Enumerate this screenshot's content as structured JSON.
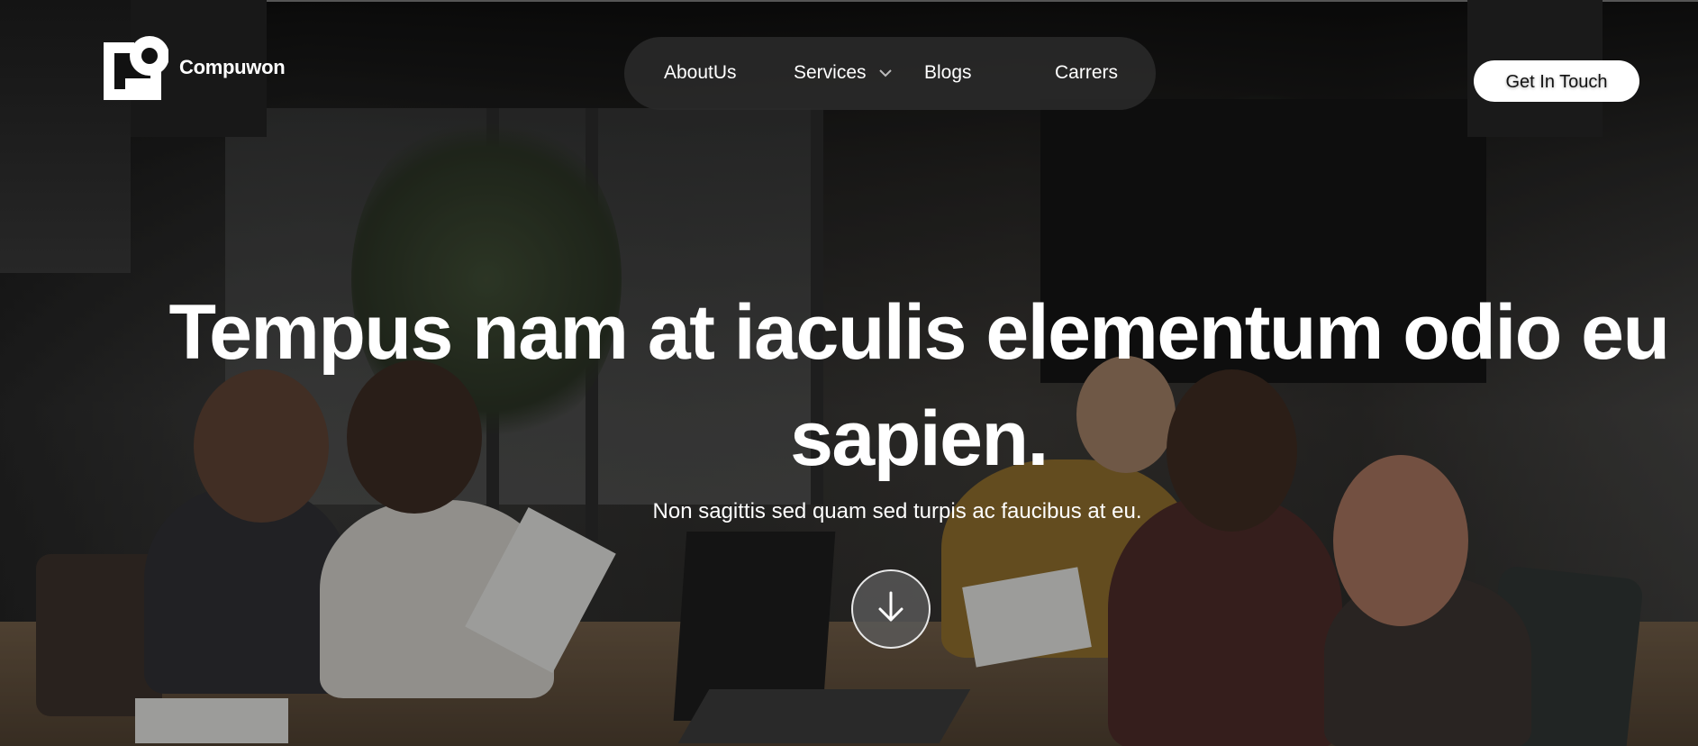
{
  "brand": {
    "name": "Compuwon",
    "logo_icon": "logo-mark-icon"
  },
  "nav": {
    "items": [
      {
        "label": "AboutUs"
      },
      {
        "label": "Services",
        "has_dropdown": true
      },
      {
        "label": "Blogs"
      },
      {
        "label": "Carrers"
      }
    ]
  },
  "header": {
    "cta_label": "Get In Touch"
  },
  "hero": {
    "headline": "Tempus nam at iaculis elementum odio eu sapien.",
    "subtitle": "Non sagittis sed quam sed turpis ac faucibus at eu.",
    "scroll_icon": "arrow-down-icon",
    "background": "office-meeting-photo"
  },
  "colors": {
    "nav_pill": "#2a2a2a",
    "text": "#ffffff",
    "cta_bg": "#ffffff",
    "cta_text": "#111111"
  }
}
